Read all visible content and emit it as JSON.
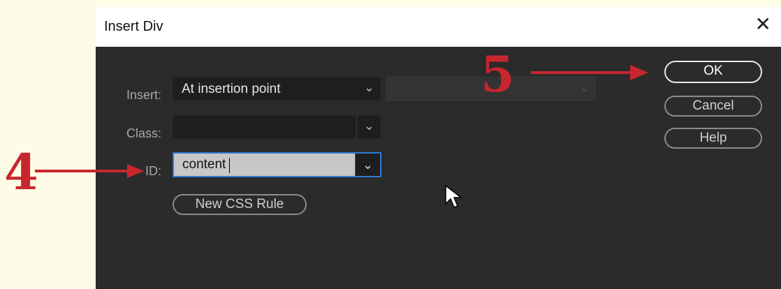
{
  "dialog": {
    "title": "Insert Div",
    "close_glyph": "✕"
  },
  "form": {
    "insert_label": "Insert:",
    "insert_value": "At insertion point",
    "insert_target_value": "",
    "class_label": "Class:",
    "class_value": "",
    "id_label": "ID:",
    "id_value": "content",
    "new_css_rule_label": "New CSS Rule"
  },
  "buttons": {
    "ok": "OK",
    "cancel": "Cancel",
    "help": "Help"
  },
  "annotations": {
    "step4": "4",
    "step5": "5"
  },
  "icons": {
    "chevron": "chevron-down-icon",
    "cursor": "mouse-pointer-icon"
  },
  "colors": {
    "annotation": "#c8262e",
    "focus": "#2f7bd2",
    "dialog_bg": "#2b2b2b"
  }
}
